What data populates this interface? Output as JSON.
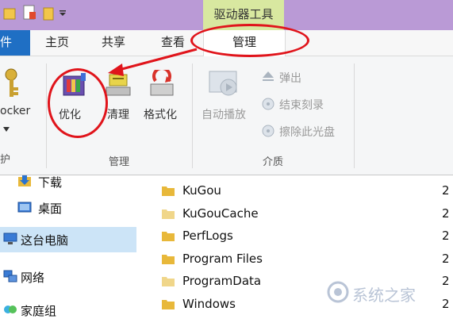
{
  "titlebar": {
    "contextual_tab_group": "驱动器工具"
  },
  "tabs": {
    "file": "件",
    "home": "主页",
    "share": "共享",
    "view": "查看",
    "manage": "管理"
  },
  "ribbon": {
    "bitlocker": "ocker",
    "protect_group": "护",
    "optimize": "优化",
    "cleanup": "清理",
    "format": "格式化",
    "manage_group": "管理",
    "autoplay": "自动播放",
    "eject": "弹出",
    "finish_burning": "结束刻录",
    "erase_disc": "擦除此光盘",
    "media_group": "介质"
  },
  "nav": {
    "items": [
      "下载",
      "桌面",
      "这台电脑",
      "网络",
      "家庭组"
    ]
  },
  "files": {
    "rows": [
      {
        "name": "KuGou",
        "date": "2"
      },
      {
        "name": "KuGouCache",
        "date": "2"
      },
      {
        "name": "PerfLogs",
        "date": "2"
      },
      {
        "name": "Program Files",
        "date": "2"
      },
      {
        "name": "ProgramData",
        "date": "2"
      },
      {
        "name": "Windows",
        "date": "2"
      }
    ]
  },
  "watermark": "系统之家",
  "colors": {
    "titlebar": "#ba9ad6",
    "contextual_tab": "#d8e8a0",
    "file_tab": "#1f6fc4",
    "annotation_red": "#e0141b",
    "folder_yellow": "#e8b83a"
  }
}
